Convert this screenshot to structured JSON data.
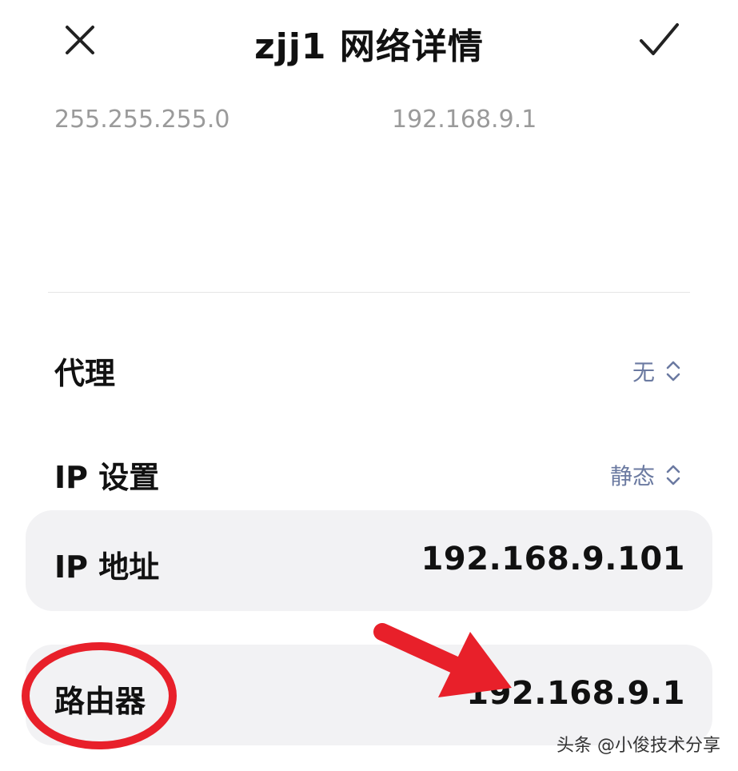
{
  "header": {
    "title": "zjj1 网络详情",
    "close_icon": "close-icon",
    "confirm_icon": "check-icon"
  },
  "top_row": {
    "subnet_mask": "255.255.255.0",
    "gateway": "192.168.9.1"
  },
  "proxy": {
    "label": "代理",
    "value": "无",
    "icon": "up-down-chevron-icon"
  },
  "ip_settings": {
    "label": "IP 设置",
    "value": "静态",
    "icon": "up-down-chevron-icon"
  },
  "ip_address": {
    "label": "IP 地址",
    "value": "192.168.9.101"
  },
  "router": {
    "label": "路由器",
    "value": "192.168.9.1"
  },
  "annotation": {
    "color": "#e8202a"
  },
  "watermark": {
    "text": "头条 @小俊技术分享"
  },
  "colors": {
    "accent_value": "#6b7aa1",
    "card_bg": "#f2f2f4",
    "annotation_red": "#e8202a"
  }
}
